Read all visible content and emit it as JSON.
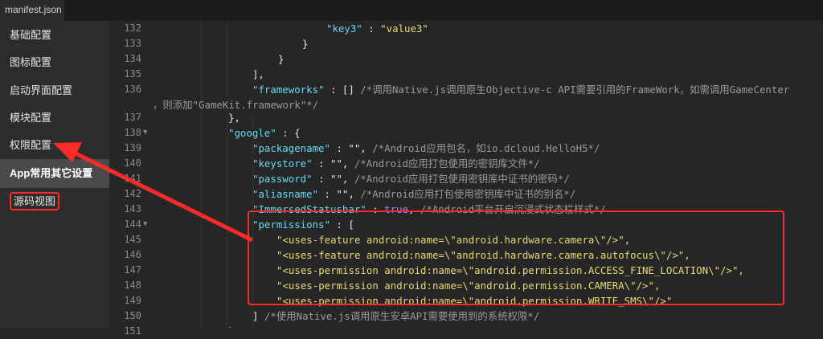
{
  "tab": {
    "title": "manifest.json"
  },
  "sidebar": {
    "items": [
      {
        "label": "基础配置"
      },
      {
        "label": "图标配置"
      },
      {
        "label": "启动界面配置"
      },
      {
        "label": "模块配置"
      },
      {
        "label": "权限配置"
      },
      {
        "label": "App常用其它设置"
      },
      {
        "label": "源码视图"
      }
    ]
  },
  "editor": {
    "line_numbers": [
      "132",
      "133",
      "134",
      "135",
      "136",
      "",
      "137",
      "138",
      "139",
      "140",
      "141",
      "142",
      "143",
      "144",
      "145",
      "146",
      "147",
      "148",
      "149",
      "150",
      "151"
    ],
    "code": {
      "l132_key": "\"key3\"",
      "l132_sep": " : ",
      "l132_val": "\"value3\"",
      "l133": "}",
      "l134": "}",
      "l135": "],",
      "l136_key": "\"frameworks\"",
      "l136_rest": " : [] ",
      "l136_comment": "/*调用Native.js调用原生Objective-c API需要引用的FrameWork，如需调用GameCenter",
      "l136b_comment": "，则添加\"GameKit.framework\"*/",
      "l137": "},",
      "l138_key": "\"google\"",
      "l138_rest": " : {",
      "l139_key": "\"packagename\"",
      "l139_rest": " : \"\", ",
      "l139_comment": "/*Android应用包名，如io.dcloud.HelloH5*/",
      "l140_key": "\"keystore\"",
      "l140_rest": " : \"\", ",
      "l140_comment": "/*Android应用打包使用的密钥库文件*/",
      "l141_key": "\"password\"",
      "l141_rest": " : \"\", ",
      "l141_comment": "/*Android应用打包使用密钥库中证书的密码*/",
      "l142_key": "\"aliasname\"",
      "l142_rest": " : \"\", ",
      "l142_comment": "/*Android应用打包使用密钥库中证书的别名*/",
      "l143_key": "\"ImmersedStatusbar\"",
      "l143_sep": " : ",
      "l143_val": "true",
      "l143_comma": ", ",
      "l143_comment": "/*Android平台开启沉浸式状态栏样式*/",
      "l144_key": "\"permissions\"",
      "l144_rest": " : [",
      "l145": "\"<uses-feature android:name=\\\"android.hardware.camera\\\"/>\",",
      "l146": "\"<uses-feature android:name=\\\"android.hardware.camera.autofocus\\\"/>\",",
      "l147": "\"<uses-permission android:name=\\\"android.permission.ACCESS_FINE_LOCATION\\\"/>\",",
      "l148": "\"<uses-permission android:name=\\\"android.permission.CAMERA\\\"/>\",",
      "l149": "\"<uses-permission android:name=\\\"android.permission.WRITE_SMS\\\"/>\"",
      "l150_rest": "] ",
      "l150_comment": "/*使用Native.js调用原生安卓API需要使用到的系统权限*/",
      "l151": "},"
    }
  },
  "colors": {
    "accent_red": "#ff2b2b",
    "key_blue": "#66d9ef",
    "string_yellow": "#e6db74",
    "comment_gray": "#9a9a9a"
  }
}
